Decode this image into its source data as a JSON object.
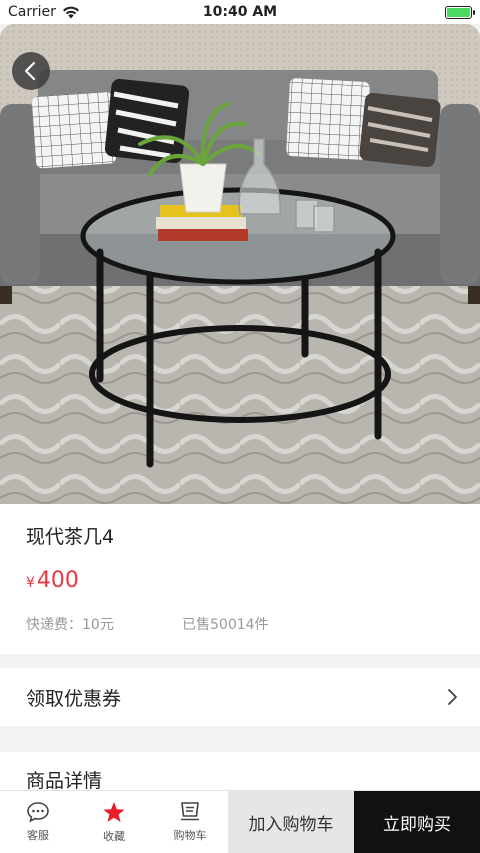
{
  "status_bar": {
    "carrier": "Carrier",
    "time": "10:40 AM",
    "battery_level": 1.0
  },
  "hero": {
    "back_icon": "chevron-left-icon"
  },
  "product": {
    "title": "现代茶几4",
    "currency": "¥",
    "price": "400",
    "shipping": "快递费：10元",
    "sold": "已售50014件"
  },
  "coupon": {
    "label": "领取优惠券",
    "icon": "chevron-right-icon"
  },
  "detail": {
    "title": "商品详情"
  },
  "bottom_bar": {
    "tabs": [
      {
        "label": "客服",
        "icon": "chat-icon"
      },
      {
        "label": "收藏",
        "icon": "star-icon"
      },
      {
        "label": "购物车",
        "icon": "cart-icon"
      }
    ],
    "add_cart_label": "加入购物车",
    "buy_now_label": "立即购买"
  },
  "colors": {
    "price": "#e8353f",
    "buy_button": "#111111",
    "add_cart_button": "#e6e6e6",
    "star": "#e8202a"
  }
}
